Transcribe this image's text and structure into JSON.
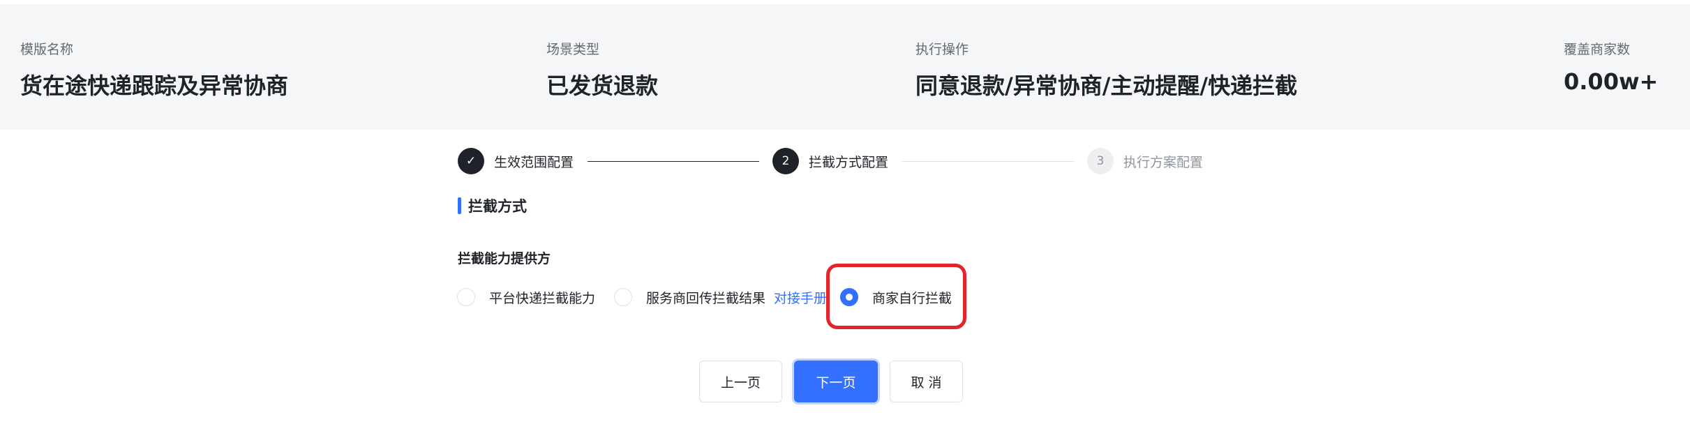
{
  "summary": {
    "template_name_label": "模版名称",
    "template_name_value": "货在途快递跟踪及异常协商",
    "scene_type_label": "场景类型",
    "scene_type_value": "已发货退款",
    "action_label": "执行操作",
    "action_value": "同意退款/异常协商/主动提醒/快递拦截",
    "merchant_count_label": "覆盖商家数",
    "merchant_count_value": "0.00w+"
  },
  "steps": [
    {
      "number": "✓",
      "label": "生效范围配置",
      "status": "done"
    },
    {
      "number": "2",
      "label": "拦截方式配置",
      "status": "active"
    },
    {
      "number": "3",
      "label": "执行方案配置",
      "status": "pending"
    }
  ],
  "section": {
    "title": "拦截方式",
    "field_label": "拦截能力提供方"
  },
  "options": [
    {
      "label": "平台快递拦截能力",
      "checked": false
    },
    {
      "label": "服务商回传拦截结果",
      "link": "对接手册",
      "checked": false
    },
    {
      "label": "商家自行拦截",
      "checked": true
    }
  ],
  "buttons": {
    "prev": "上一页",
    "next": "下一页",
    "cancel": "取 消"
  },
  "colors": {
    "accent": "#3370ff",
    "highlight": "#e3242b",
    "header_bg": "#f5f6f8"
  }
}
